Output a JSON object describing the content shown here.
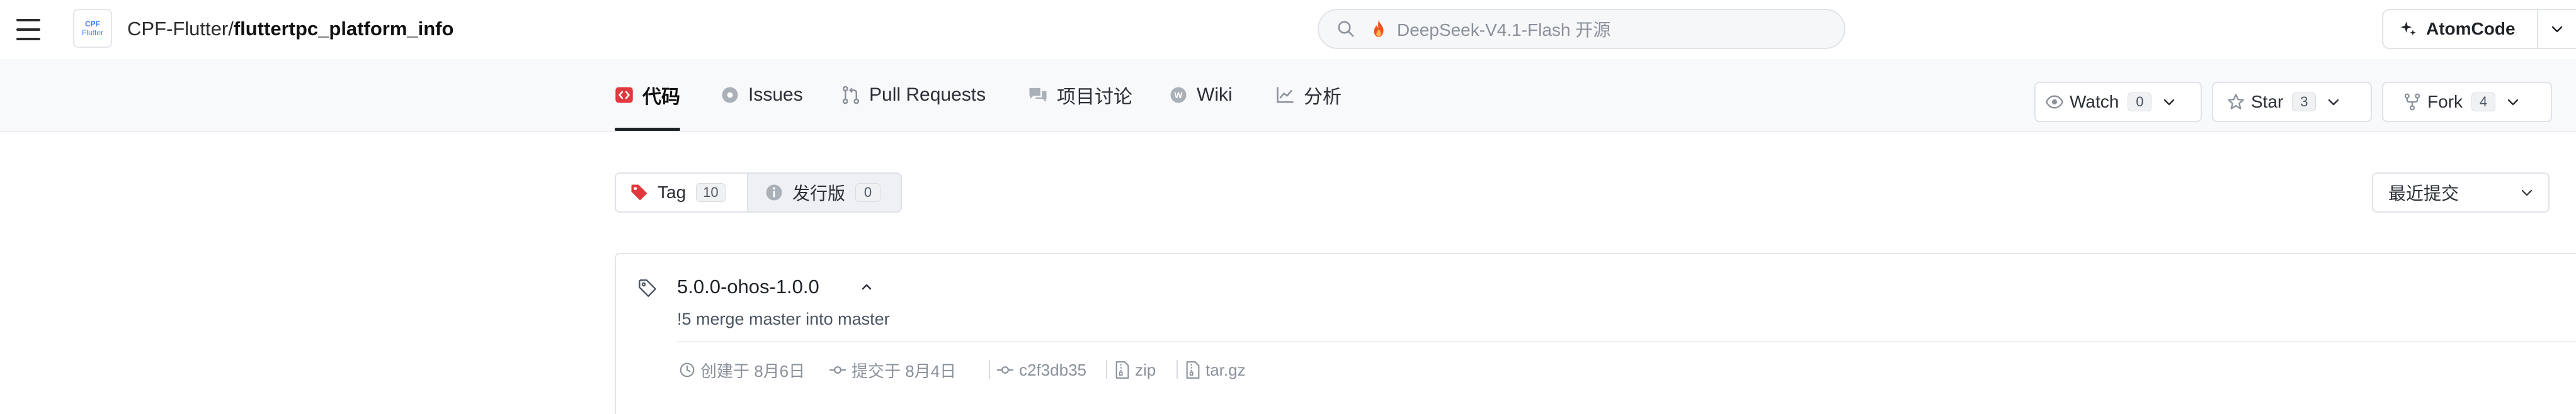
{
  "header": {
    "logo": {
      "line1": "CPF",
      "line2": "Flutter"
    },
    "repo_owner": "CPF-Flutter",
    "repo_sep": "/",
    "repo_name": "fluttertpc_platform_info",
    "search_placeholder": "DeepSeek-V4.1-Flash 开源",
    "atom_button": "AtomCode"
  },
  "nav": {
    "tabs": [
      {
        "label": "代码",
        "icon": "code-icon",
        "active": true
      },
      {
        "label": "Issues",
        "icon": "issue-icon"
      },
      {
        "label": "Pull Requests",
        "icon": "pull-request-icon"
      },
      {
        "label": "项目讨论",
        "icon": "discussion-icon"
      },
      {
        "label": "Wiki",
        "icon": "wiki-icon"
      },
      {
        "label": "分析",
        "icon": "analytics-icon"
      }
    ],
    "watch": {
      "label": "Watch",
      "count": "0"
    },
    "star": {
      "label": "Star",
      "count": "3"
    },
    "fork": {
      "label": "Fork",
      "count": "4"
    }
  },
  "toolbar": {
    "tag_tab": {
      "label": "Tag",
      "count": "10"
    },
    "release_tab": {
      "label": "发行版",
      "count": "0"
    },
    "sort_label": "最近提交"
  },
  "tags": [
    {
      "name": "5.0.0-ohos-1.0.0",
      "message": "!5 merge master into master",
      "created": "创建于 8月6日",
      "committed": "提交于 8月4日",
      "sha": "c2f3db35",
      "zip": "zip",
      "targz": "tar.gz"
    }
  ],
  "colors": {
    "accent_red": "#e0393e",
    "text": "#1f2328",
    "muted": "#8a919b",
    "border": "#dfe3e8"
  }
}
